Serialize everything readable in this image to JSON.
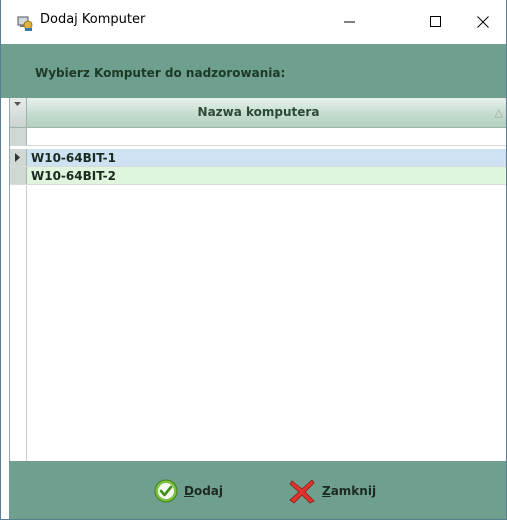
{
  "window": {
    "title": "Dodaj Komputer",
    "controls": {
      "minimize": "—",
      "maximize": "☐",
      "close": "✕"
    }
  },
  "header": {
    "label": "Wybierz Komputer do nadzorowania:"
  },
  "grid": {
    "column_header": "Nazwa komputera",
    "rows": [
      {
        "name": "W10-64BIT-1",
        "selected": true
      },
      {
        "name": "W10-64BIT-2",
        "selected": false
      }
    ]
  },
  "footer": {
    "dodaj_first": "D",
    "dodaj_rest": "odaj",
    "zamknij_first": "Z",
    "zamknij_rest": "amknij"
  },
  "colors": {
    "header_bg": "#6f9f8e",
    "selected_row": "#cfe2f3",
    "alt_row": "#dff5dd",
    "label_text": "#1c3a26"
  },
  "icons": [
    "app-icon",
    "minimize-icon",
    "maximize-icon",
    "close-icon",
    "row-pointer-icon",
    "sort-icon",
    "check-icon",
    "x-icon"
  ]
}
